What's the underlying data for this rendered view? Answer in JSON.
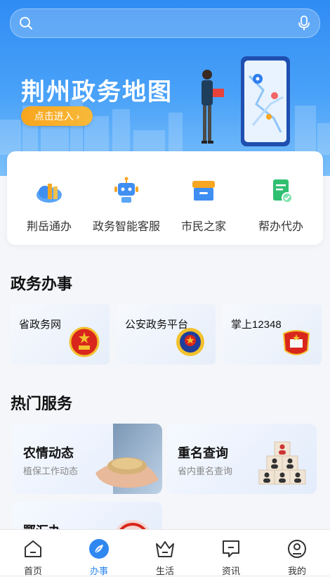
{
  "banner": {
    "title": "荆州政务地图",
    "enter_label": "点击进入",
    "enter_chevron": "›"
  },
  "search": {
    "placeholder": "",
    "search_icon": "search-icon",
    "mic_icon": "microphone-icon"
  },
  "quick_actions": [
    {
      "label": "荆岳通办",
      "icon": "cloud-buildings-icon"
    },
    {
      "label": "政务智能客服",
      "icon": "robot-icon"
    },
    {
      "label": "市民之家",
      "icon": "storefront-icon"
    },
    {
      "label": "帮办代办",
      "icon": "checked-document-icon"
    }
  ],
  "gov_section": {
    "title": "政务办事",
    "cards": [
      {
        "label": "省政务网",
        "icon": "national-emblem-icon"
      },
      {
        "label": "公安政务平台",
        "icon": "police-emblem-icon"
      },
      {
        "label": "掌上12348",
        "icon": "court-emblem-icon"
      }
    ]
  },
  "hot_section": {
    "title": "热门服务",
    "cards": [
      {
        "title": "农情动态",
        "subtitle": "植保工作动态",
        "icon": "hands-with-grain-image"
      },
      {
        "title": "重名查询",
        "subtitle": "省内重名查询",
        "icon": "people-pyramid-icon"
      },
      {
        "title": "鄂汇办",
        "subtitle": "",
        "icon": "seal-image"
      }
    ]
  },
  "tabbar": {
    "active": "办事",
    "tabs": [
      {
        "label": "首页",
        "icon": "home-icon"
      },
      {
        "label": "办事",
        "icon": "leaf-icon"
      },
      {
        "label": "生活",
        "icon": "basket-icon"
      },
      {
        "label": "资讯",
        "icon": "message-icon"
      },
      {
        "label": "我的",
        "icon": "profile-icon"
      }
    ]
  },
  "colors": {
    "primary": "#2f87f0",
    "banner_top": "#2f8cf3",
    "enter_button": "#f8a51d",
    "emblem_red": "#d9261c",
    "emblem_gold": "#f2c12e"
  }
}
